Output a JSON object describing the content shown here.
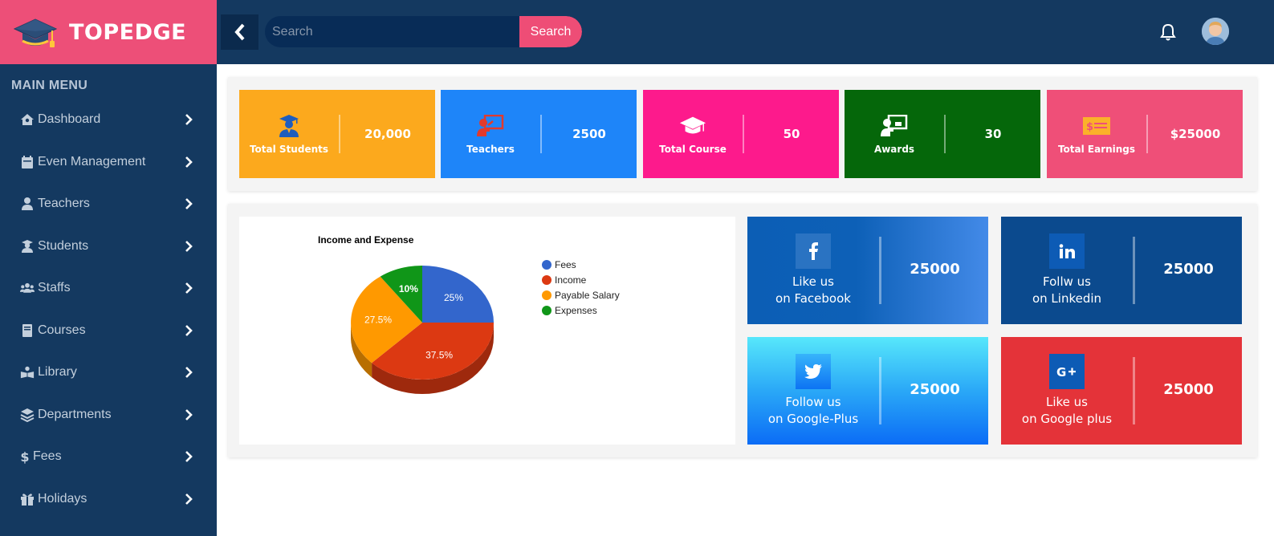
{
  "brand": {
    "name": "TOPEDGE"
  },
  "sidebar": {
    "title": "MAIN MENU",
    "items": [
      {
        "label": "Dashboard",
        "icon": "home-icon"
      },
      {
        "label": "Even Management",
        "icon": "calendar-icon"
      },
      {
        "label": "Teachers",
        "icon": "user-icon"
      },
      {
        "label": "Students",
        "icon": "graduate-icon"
      },
      {
        "label": "Staffs",
        "icon": "users-icon"
      },
      {
        "label": "Courses",
        "icon": "book-icon"
      },
      {
        "label": "Library",
        "icon": "reader-icon"
      },
      {
        "label": "Departments",
        "icon": "layers-icon"
      },
      {
        "label": "Fees",
        "icon": "dollar-icon"
      },
      {
        "label": "Holidays",
        "icon": "gift-icon"
      }
    ]
  },
  "header": {
    "search_placeholder": "Search",
    "search_button": "Search"
  },
  "stats": [
    {
      "label": "Total Students",
      "value": "20,000",
      "color": "#fca91d",
      "icon": "graduate-icon"
    },
    {
      "label": "Teachers",
      "value": "2500",
      "color": "#1e85f9",
      "icon": "teacher-board-icon"
    },
    {
      "label": "Total Course",
      "value": "50",
      "color": "#fd1a8c",
      "icon": "graduation-cap-icon"
    },
    {
      "label": "Awards",
      "value": "30",
      "color": "#05670a",
      "icon": "presenter-icon"
    },
    {
      "label": "Total Earnings",
      "value": "$25000",
      "color": "#ef4f78",
      "icon": "money-icon"
    }
  ],
  "social": {
    "facebook": {
      "line1": "Like us",
      "line2": "on Facebook",
      "value": "25000",
      "icon": "facebook-icon"
    },
    "linkedin": {
      "line1": "Follw us",
      "line2": "on Linkedin",
      "value": "25000",
      "icon": "linkedin-icon"
    },
    "twitter": {
      "line1": "Follow us",
      "line2": "on Google-Plus",
      "value": "25000",
      "icon": "twitter-icon"
    },
    "googleplus": {
      "line1": "Like us",
      "line2": "on Google plus",
      "value": "25000",
      "icon": "google-plus-icon"
    }
  },
  "chart_data": {
    "type": "pie",
    "title": "Income and Expense",
    "legend": "right",
    "slices": [
      {
        "label": "Fees",
        "value": 25,
        "text": "25%",
        "color": "#3366cc"
      },
      {
        "label": "Income",
        "value": 37.5,
        "text": "37.5%",
        "color": "#dc3912"
      },
      {
        "label": "Payable Salary",
        "value": 27.5,
        "text": "27.5%",
        "color": "#ff9900"
      },
      {
        "label": "Expenses",
        "value": 10,
        "text": "10%",
        "color": "#109618"
      }
    ]
  }
}
